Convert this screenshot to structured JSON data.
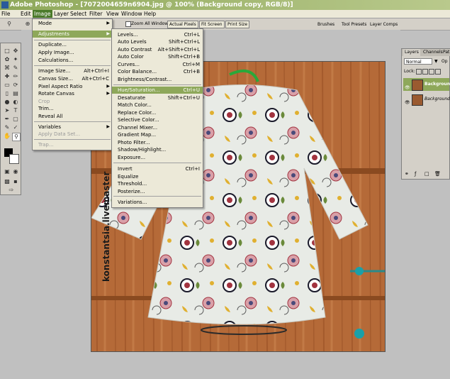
{
  "window": {
    "title": "Adobe Photoshop - [7072004659n6904.jpg @ 100% (Background copy, RGB/8)]"
  },
  "menubar": {
    "items": [
      "File",
      "Edit",
      "Image",
      "Layer",
      "Select",
      "Filter",
      "View",
      "Window",
      "Help"
    ]
  },
  "options": {
    "zoom_all_windows": "Zoom All Windows",
    "actual_pixels": "Actual Pixels",
    "fit_screen": "Fit Screen",
    "print_size": "Print Size"
  },
  "palette_tabs": [
    "Brushes",
    "Tool Presets",
    "Layer Comps"
  ],
  "image_menu": {
    "items": [
      {
        "label": "Mode",
        "shortcut": "",
        "submenu": true
      },
      {
        "label": "Adjustments",
        "shortcut": "",
        "submenu": true,
        "highlight": true
      },
      {
        "label": "Duplicate...",
        "shortcut": ""
      },
      {
        "label": "Apply Image...",
        "shortcut": ""
      },
      {
        "label": "Calculations...",
        "shortcut": ""
      },
      {
        "label": "Image Size...",
        "shortcut": "Alt+Ctrl+I"
      },
      {
        "label": "Canvas Size...",
        "shortcut": "Alt+Ctrl+C"
      },
      {
        "label": "Pixel Aspect Ratio",
        "shortcut": "",
        "submenu": true
      },
      {
        "label": "Rotate Canvas",
        "shortcut": "",
        "submenu": true
      },
      {
        "label": "Crop",
        "shortcut": "",
        "disabled": true
      },
      {
        "label": "Trim...",
        "shortcut": ""
      },
      {
        "label": "Reveal All",
        "shortcut": ""
      },
      {
        "label": "Variables",
        "shortcut": "",
        "submenu": true
      },
      {
        "label": "Apply Data Set...",
        "shortcut": "",
        "disabled": true
      },
      {
        "label": "Trap...",
        "shortcut": "",
        "disabled": true
      }
    ]
  },
  "adjust_menu": {
    "items": [
      {
        "label": "Levels...",
        "shortcut": "Ctrl+L"
      },
      {
        "label": "Auto Levels",
        "shortcut": "Shift+Ctrl+L"
      },
      {
        "label": "Auto Contrast",
        "shortcut": "Alt+Shift+Ctrl+L"
      },
      {
        "label": "Auto Color",
        "shortcut": "Shift+Ctrl+B"
      },
      {
        "label": "Curves...",
        "shortcut": "Ctrl+M"
      },
      {
        "label": "Color Balance...",
        "shortcut": "Ctrl+B"
      },
      {
        "label": "Brightness/Contrast...",
        "shortcut": ""
      },
      {
        "label": "Hue/Saturation...",
        "shortcut": "Ctrl+U",
        "highlight": true
      },
      {
        "label": "Desaturate",
        "shortcut": "Shift+Ctrl+U"
      },
      {
        "label": "Match Color...",
        "shortcut": ""
      },
      {
        "label": "Replace Color...",
        "shortcut": ""
      },
      {
        "label": "Selective Color...",
        "shortcut": ""
      },
      {
        "label": "Channel Mixer...",
        "shortcut": ""
      },
      {
        "label": "Gradient Map...",
        "shortcut": ""
      },
      {
        "label": "Photo Filter...",
        "shortcut": ""
      },
      {
        "label": "Shadow/Highlight...",
        "shortcut": ""
      },
      {
        "label": "Exposure...",
        "shortcut": ""
      },
      {
        "label": "Invert",
        "shortcut": "Ctrl+I"
      },
      {
        "label": "Equalize",
        "shortcut": ""
      },
      {
        "label": "Threshold...",
        "shortcut": ""
      },
      {
        "label": "Posterize...",
        "shortcut": ""
      },
      {
        "label": "Variations...",
        "shortcut": ""
      }
    ]
  },
  "layers_panel": {
    "tabs": [
      "Layers",
      "Channels",
      "Pat"
    ],
    "blend_mode": "Normal",
    "opacity_label": "Op",
    "lock_label": "Lock:",
    "layers": [
      {
        "name": "Background",
        "selected": true
      },
      {
        "name": "Background",
        "selected": false
      }
    ]
  },
  "watermark": "konstantsia.livemaster"
}
